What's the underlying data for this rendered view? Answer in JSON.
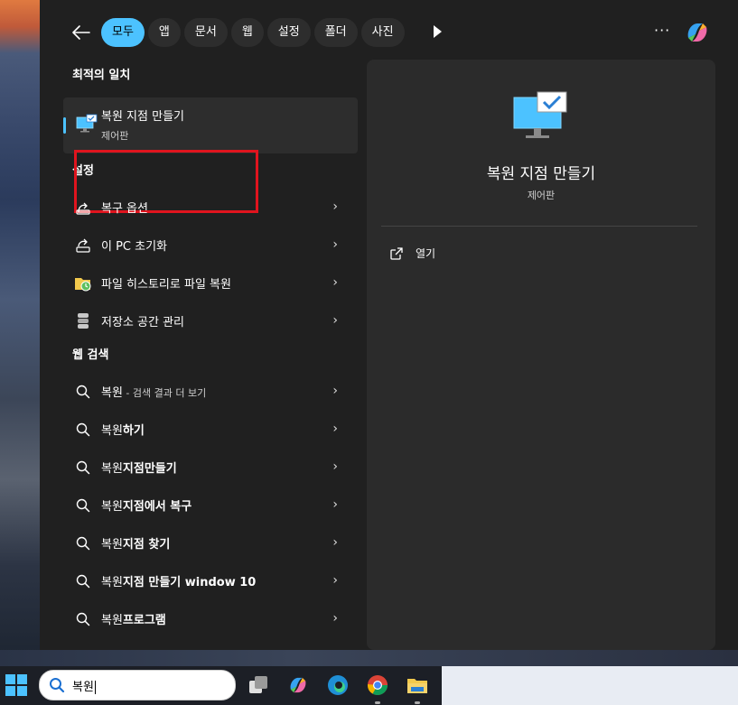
{
  "topbar": {
    "back_icon": "arrow-left-icon",
    "tabs": [
      {
        "label": "모두",
        "active": true
      },
      {
        "label": "앱"
      },
      {
        "label": "문서"
      },
      {
        "label": "웹"
      },
      {
        "label": "설정"
      },
      {
        "label": "폴더"
      },
      {
        "label": "사진"
      }
    ],
    "more_label": "···"
  },
  "best_match": {
    "section_title": "최적의 일치",
    "title": "복원 지점 만들기",
    "subtitle": "제어판",
    "icon": "monitor-check-icon"
  },
  "settings": {
    "section_title": "설정",
    "items": [
      {
        "label": "복구 옵션",
        "icon": "recovery-icon"
      },
      {
        "label": "이 PC 초기화",
        "icon": "reset-pc-icon"
      },
      {
        "label": "파일 히스토리로 파일 복원",
        "icon": "file-history-icon"
      },
      {
        "label": "저장소 공간 관리",
        "icon": "storage-icon"
      }
    ]
  },
  "web": {
    "section_title": "웹 검색",
    "items": [
      {
        "prefix": "복원",
        "bold": "",
        "suffix": " - 검색 결과 더 보기"
      },
      {
        "prefix": "복원",
        "bold": "하기",
        "suffix": ""
      },
      {
        "prefix": "복원",
        "bold": "지점만들기",
        "suffix": ""
      },
      {
        "prefix": "복원",
        "bold": "지점에서 복구",
        "suffix": ""
      },
      {
        "prefix": "복원",
        "bold": "지점 찾기",
        "suffix": ""
      },
      {
        "prefix": "복원",
        "bold": "지점 만들기 window 10",
        "suffix": ""
      },
      {
        "prefix": "복원",
        "bold": "프로그램",
        "suffix": ""
      }
    ]
  },
  "preview": {
    "title": "복원 지점 만들기",
    "subtitle": "제어판",
    "open_label": "열기"
  },
  "taskbar": {
    "search_value": "복원"
  },
  "colors": {
    "accent": "#4cc2ff",
    "panel_bg": "#202020",
    "preview_bg": "#2b2b2b",
    "highlight_box": "#e0141e"
  }
}
